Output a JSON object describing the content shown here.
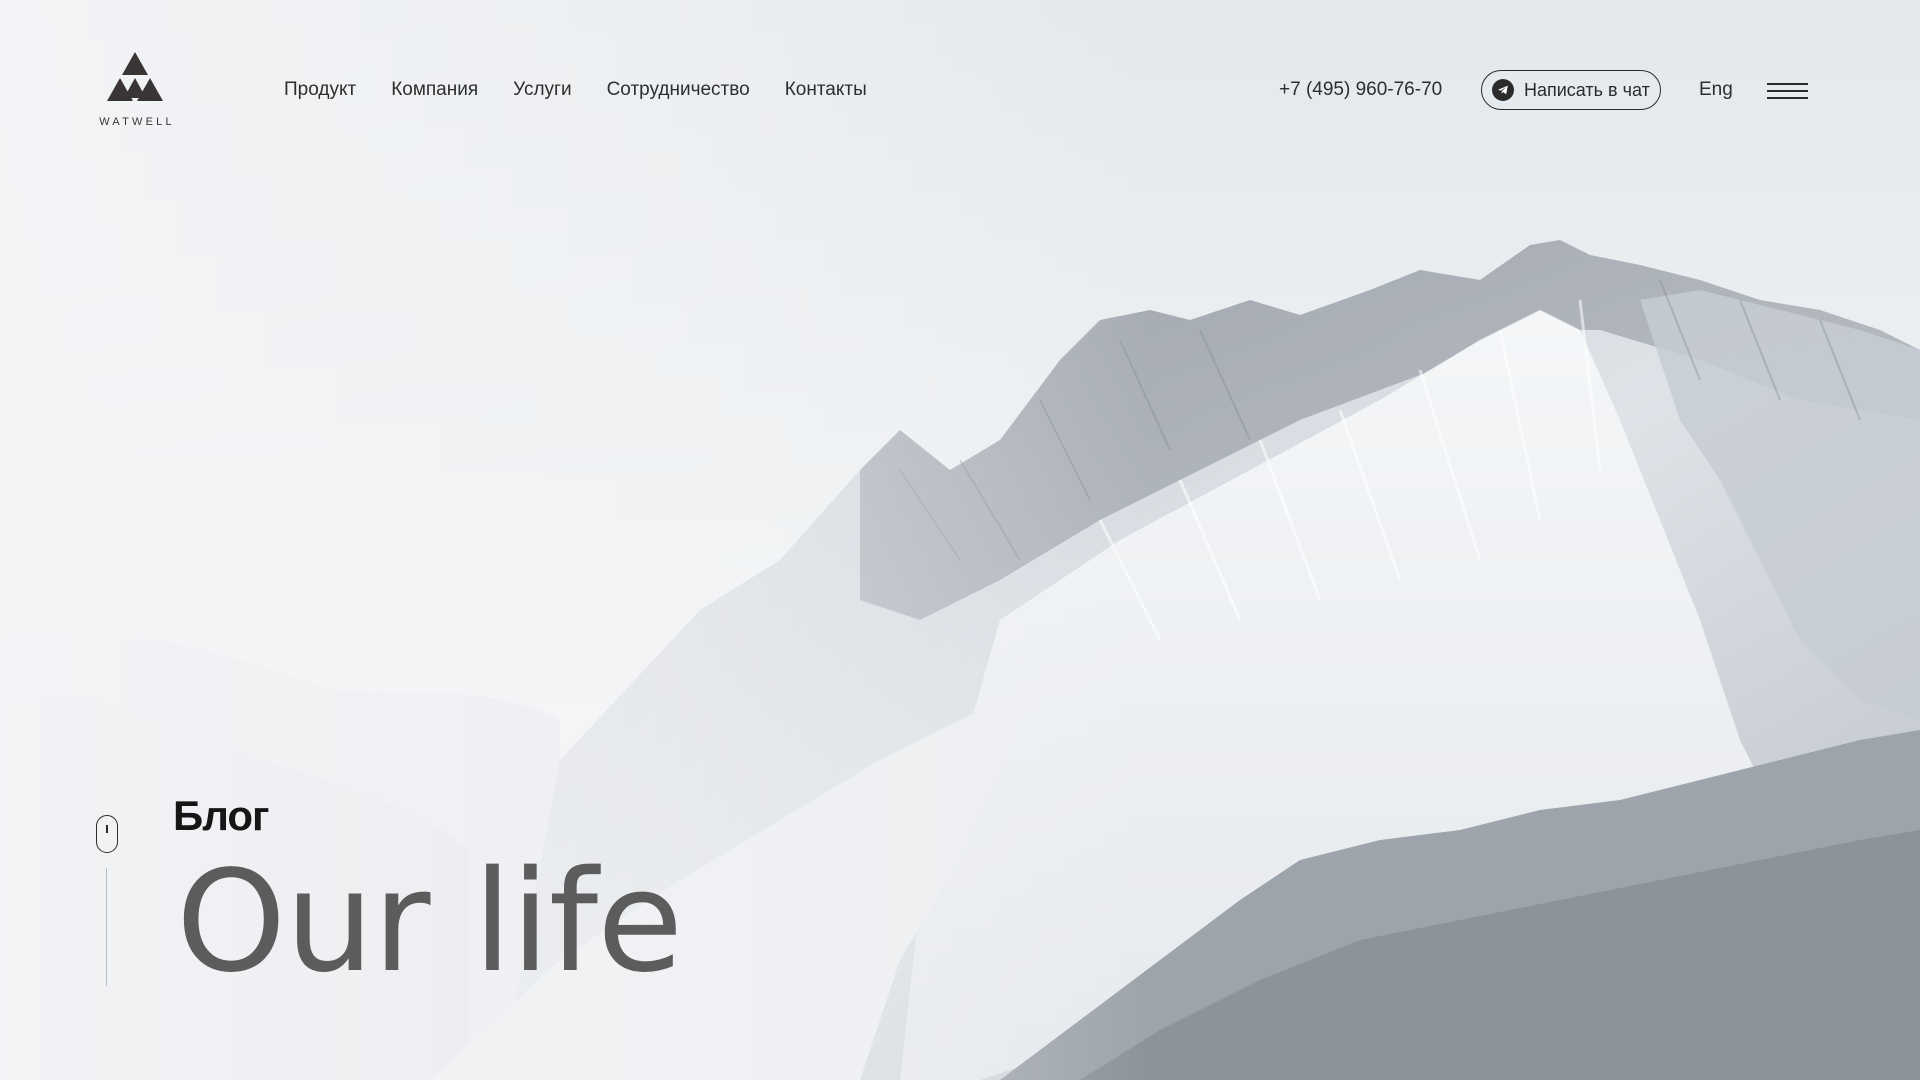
{
  "brand": {
    "logo_text": "WATWELL",
    "logo_icon": "triangle-mountain-logo-icon",
    "logo_color": "#3a3535"
  },
  "nav": {
    "items": [
      {
        "label": "Продукт"
      },
      {
        "label": "Компания"
      },
      {
        "label": "Услуги"
      },
      {
        "label": "Сотрудничество"
      },
      {
        "label": "Контакты"
      }
    ]
  },
  "header": {
    "phone": "+7 (495) 960-76-70",
    "chat_button_label": "Написать в чат",
    "chat_icon": "telegram-icon",
    "language": "Eng",
    "menu_icon": "hamburger-menu-icon"
  },
  "hero": {
    "section_label": "Блог",
    "title": "Our life",
    "background": "snowy-mountain-landscape",
    "scroll_icon": "mouse-scroll-icon"
  },
  "colors": {
    "text_primary": "#2b2b2b",
    "title_gray": "#5c5c5c",
    "sky": "#e8ecef"
  }
}
